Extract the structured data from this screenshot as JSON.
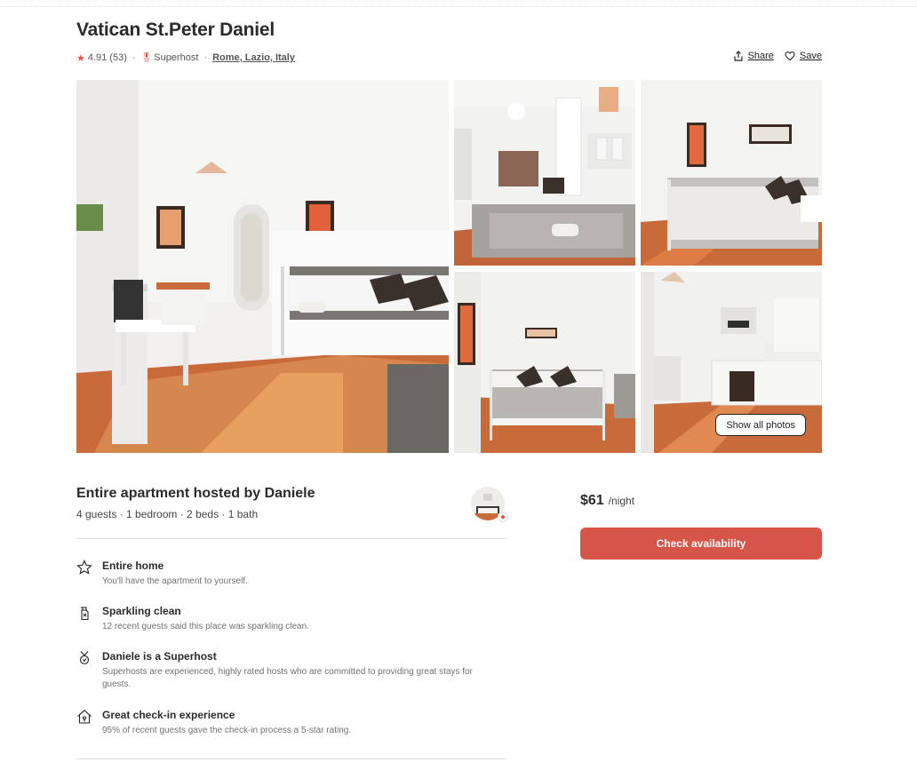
{
  "listing": {
    "title": "Vatican St.Peter Daniel",
    "rating": "4.91",
    "reviews": "(53)",
    "superhost_label": "Superhost",
    "location": "Rome, Lazio, Italy"
  },
  "actions": {
    "share": "Share",
    "save": "Save"
  },
  "gallery": {
    "show_all": "Show all photos",
    "photos": [
      "living-room-photo",
      "studio-overview-photo",
      "bedroom-photo",
      "bed-front-photo",
      "kitchen-photo"
    ]
  },
  "host": {
    "heading": "Entire apartment hosted by Daniele",
    "details": "4 guests · 1 bedroom · 2 beds · 1 bath"
  },
  "features": [
    {
      "icon": "home-star-icon",
      "title": "Entire home",
      "desc": "You'll have the apartment to yourself."
    },
    {
      "icon": "spray-bottle-icon",
      "title": "Sparkling clean",
      "desc": "12 recent guests said this place was sparkling clean."
    },
    {
      "icon": "medal-icon",
      "title": "Daniele is a Superhost",
      "desc": "Superhosts are experienced, highly rated hosts who are committed to providing great stays for guests."
    },
    {
      "icon": "house-key-icon",
      "title": "Great check-in experience",
      "desc": "95% of recent guests gave the check-in process a 5-star rating."
    }
  ],
  "booking": {
    "price": "$61",
    "per": "/night",
    "cta": "Check availability"
  },
  "colors": {
    "accent": "#d75548",
    "star": "#e0503e",
    "text": "#222222",
    "muted": "#717171"
  }
}
